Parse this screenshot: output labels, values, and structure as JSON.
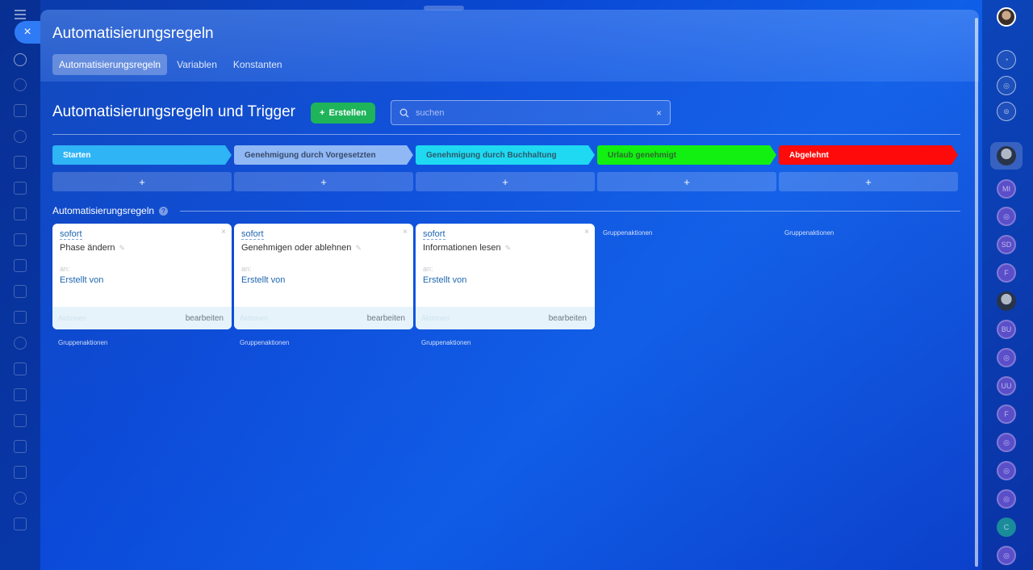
{
  "panel": {
    "title": "Automatisierungsregeln",
    "tabs": [
      {
        "label": "Automatisierungsregeln",
        "active": true
      },
      {
        "label": "Variablen",
        "active": false
      },
      {
        "label": "Konstanten",
        "active": false
      }
    ]
  },
  "main": {
    "heading": "Automatisierungsregeln und Trigger",
    "create_label": "Erstellen",
    "search_placeholder": "suchen"
  },
  "stages": [
    {
      "label": "Starten",
      "color": "#2fb4f5",
      "text_color": "#ffffff"
    },
    {
      "label": "Genehmigung durch Vorgesetzten",
      "color": "#8fb8f5",
      "text_color": "#3a4a6a"
    },
    {
      "label": "Genehmigung durch Buchhaltung",
      "color": "#1fd9f2",
      "text_color": "#2d5a6a"
    },
    {
      "label": "Urlaub genehmigt",
      "color": "#12f012",
      "text_color": "#2d6a2d"
    },
    {
      "label": "Abgelehnt",
      "color": "#ff0a0a",
      "text_color": "#ffffff"
    }
  ],
  "add_symbol": "+",
  "rules_section": {
    "label": "Automatisierungsregeln",
    "help": "?"
  },
  "cards": [
    {
      "trigger": "sofort",
      "name": "Phase ändern",
      "to_label": "an:",
      "to_value": "Erstellt von",
      "actions": "Aktionen",
      "edit": "bearbeiten"
    },
    {
      "trigger": "sofort",
      "name": "Genehmigen oder ablehnen",
      "to_label": "an:",
      "to_value": "Erstellt von",
      "actions": "Aktionen",
      "edit": "bearbeiten"
    },
    {
      "trigger": "sofort",
      "name": "Informationen lesen",
      "to_label": "an:",
      "to_value": "Erstellt von",
      "actions": "Aktionen",
      "edit": "bearbeiten"
    }
  ],
  "group_actions_label": "Gruppenaktionen",
  "right_rail": {
    "avatars": [
      "MI",
      "SD",
      "F",
      "BU",
      "UU",
      "F",
      "C"
    ]
  },
  "icons": {
    "close": "×",
    "search": "search-icon",
    "plus": "+",
    "pencil": "✎"
  }
}
